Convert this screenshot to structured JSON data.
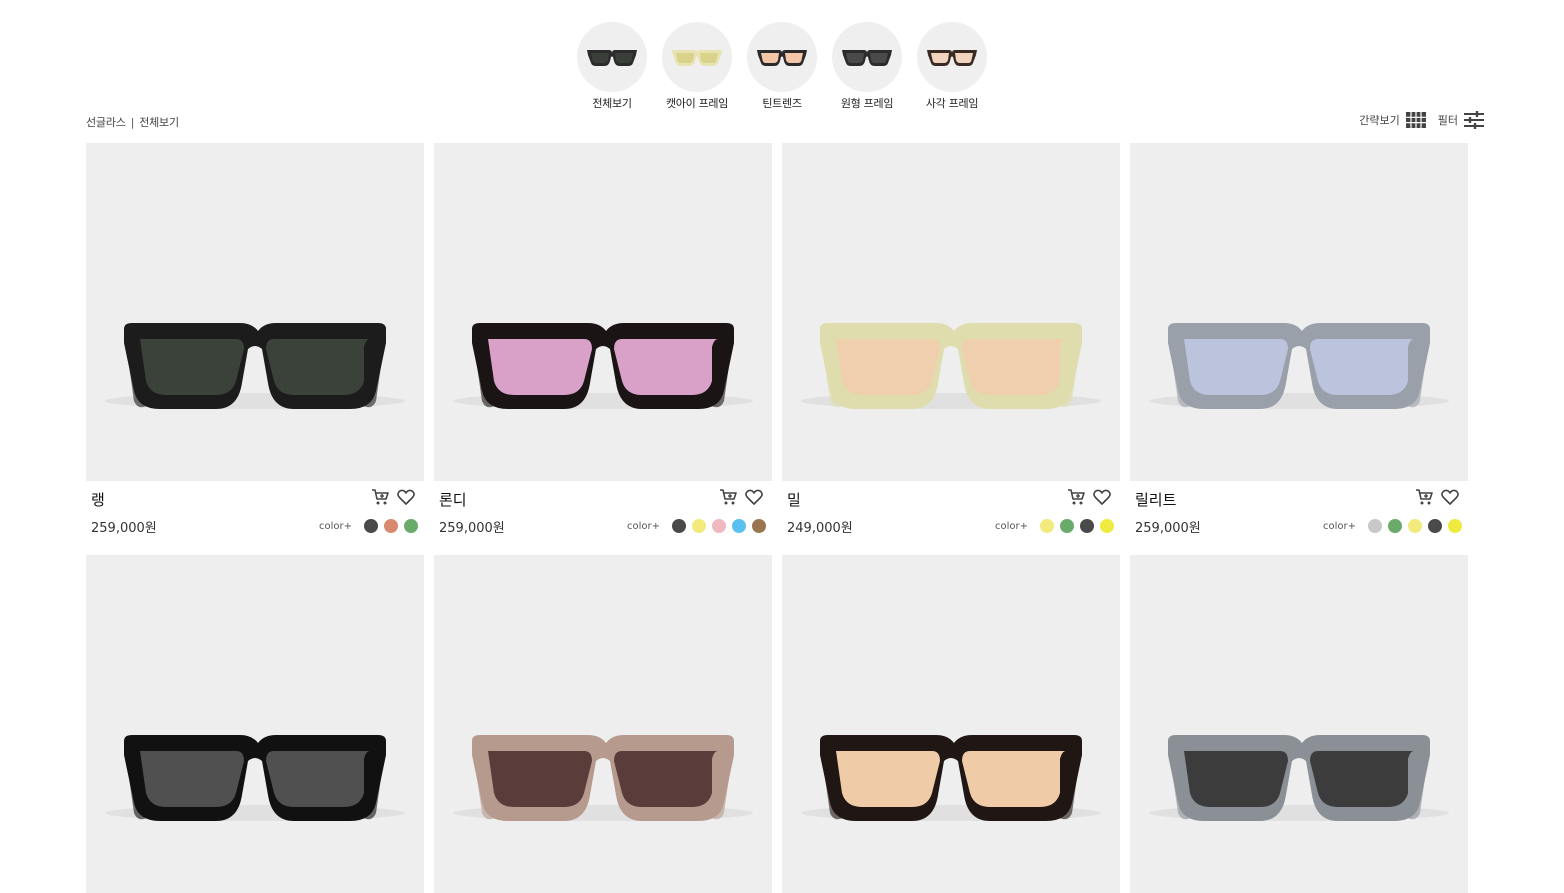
{
  "categories": [
    {
      "label": "전체보기",
      "icon": "sunglasses-black-icon",
      "frame": "#2b2b2b",
      "lens": "#3a3f3a"
    },
    {
      "label": "캣아이 프레임",
      "icon": "sunglasses-cateye-icon",
      "frame": "#e8e3b0",
      "lens": "#d9d28a"
    },
    {
      "label": "틴트렌즈",
      "icon": "sunglasses-tint-icon",
      "frame": "#2a2a2a",
      "lens": "#f4c6a8"
    },
    {
      "label": "원형 프레임",
      "icon": "sunglasses-round-icon",
      "frame": "#2b2b2b",
      "lens": "#4a4a4a"
    },
    {
      "label": "사각 프레임",
      "icon": "sunglasses-square-icon",
      "frame": "#3a2a24",
      "lens": "#f2d3bd"
    }
  ],
  "breadcrumb": {
    "category": "선글라스",
    "separator": "|",
    "current": "전체보기"
  },
  "tools": {
    "simple_view_label": "간략보기",
    "filter_label": "필터"
  },
  "swatch_label": "color+",
  "products": [
    {
      "name": "랭",
      "price": "259,000원",
      "frame": "#1c1c1c",
      "lens": "#3b4239",
      "colors": [
        "#4a4a4a",
        "#d98a6e",
        "#6aaa6a"
      ]
    },
    {
      "name": "론디",
      "price": "259,000원",
      "frame": "#1a1414",
      "lens": "#d9a0c8",
      "colors": [
        "#4a4a4a",
        "#f2ea7c",
        "#f0b8c0",
        "#5cc0ee",
        "#9a7650"
      ]
    },
    {
      "name": "밀",
      "price": "249,000원",
      "frame": "#dfdcae",
      "lens": "#f0cfae",
      "colors": [
        "#f2ea7c",
        "#6aaa6a",
        "#4a4a4a",
        "#eeea40"
      ]
    },
    {
      "name": "릴리트",
      "price": "259,000원",
      "frame": "#9aa0aa",
      "lens": "#bcc3dc",
      "colors": [
        "#c8c8c8",
        "#6aaa6a",
        "#f2ea7c",
        "#4a4a4a",
        "#eeea40"
      ]
    },
    {
      "name": "",
      "price": "",
      "frame": "#111111",
      "lens": "#505050",
      "colors": []
    },
    {
      "name": "",
      "price": "",
      "frame": "#b59a8d",
      "lens": "#5a3c3a",
      "colors": []
    },
    {
      "name": "",
      "price": "",
      "frame": "#201614",
      "lens": "#f0cba8",
      "colors": []
    },
    {
      "name": "",
      "price": "",
      "frame": "#8a9096",
      "lens": "#3c3c3c",
      "colors": []
    }
  ]
}
